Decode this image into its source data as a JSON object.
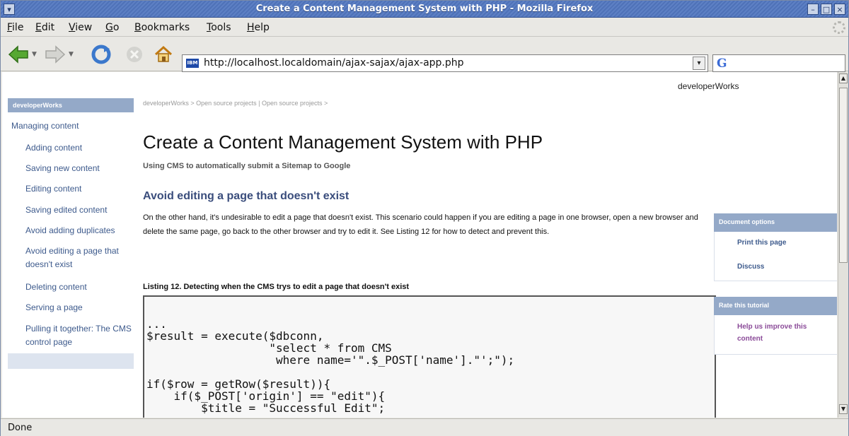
{
  "window": {
    "title": "Create a Content Management System with PHP - Mozilla Firefox"
  },
  "menubar": {
    "items": [
      {
        "label": "File",
        "accel": "F"
      },
      {
        "label": "Edit",
        "accel": "E"
      },
      {
        "label": "View",
        "accel": "V"
      },
      {
        "label": "Go",
        "accel": "G"
      },
      {
        "label": "Bookmarks",
        "accel": "B"
      },
      {
        "label": "Tools",
        "accel": "T"
      },
      {
        "label": "Help",
        "accel": "H"
      }
    ]
  },
  "toolbar": {
    "url": "http://localhost.localdomain/ajax-sajax/ajax-app.php",
    "site_icon_label": "IBM",
    "search_engine_glyph": "G"
  },
  "page": {
    "brand": "developerWorks",
    "leftnav": {
      "header": "developerWorks",
      "top_item": "Managing content",
      "items": [
        "Adding content",
        "Saving new content",
        "Editing content",
        "Saving edited content",
        "Avoid adding duplicates",
        "Avoid editing a page that doesn't exist",
        "Deleting content",
        "Serving a page",
        "Pulling it together: The CMS control page"
      ]
    },
    "breadcrumb": "developerWorks  >  Open source projects | Open source projects  >",
    "title": "Create a Content Management System with PHP",
    "subtitle": "Using CMS to automatically submit a Sitemap to Google",
    "section_heading": "Avoid editing a page that doesn't exist",
    "paragraph": "On the other hand, it's undesirable to edit a page that doesn't exist. This scenario could happen if you are editing a page in one browser, open a new browser and delete the same page, go back to the other browser and try to edit it. See Listing 12 for how to detect and prevent this.",
    "listing_caption": "Listing 12. Detecting when the CMS trys to edit a page that doesn't exist",
    "code": "...\n$result = execute($dbconn,\n                  \"select * from CMS\n                   where name='\".$_POST['name'].\"';\");\n\nif($row = getRow($result)){\n    if($_POST['origin'] == \"edit\"){\n        $title = \"Successful Edit\";",
    "doc_options": {
      "header": "Document options",
      "print": "Print this page",
      "discuss": "Discuss"
    },
    "rate": {
      "header": "Rate this tutorial",
      "link": "Help us improve this content"
    }
  },
  "statusbar": {
    "text": "Done"
  }
}
